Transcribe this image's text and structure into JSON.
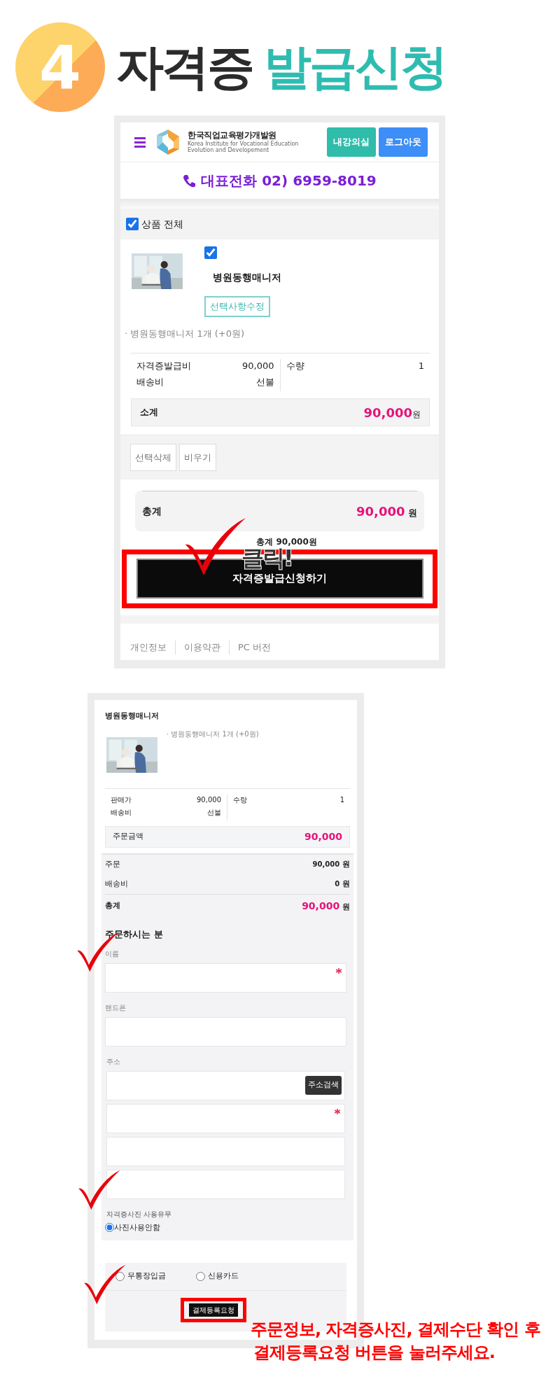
{
  "heading": {
    "step": "4",
    "title_dark": "자격증",
    "title_accent": "발급신청"
  },
  "cart_screen": {
    "header": {
      "logo_name": "한국직업교육평가개발원",
      "logo_lines": [
        "Korea Institute for Vocational Education",
        "Evolution and Developement"
      ],
      "buttons": [
        "내강의실",
        "로그아웃"
      ]
    },
    "phone": "대표전화 02) 6959-8019",
    "select_all": {
      "label": "상품 전체",
      "checked": true
    },
    "item": {
      "checked": true,
      "name": "병원동행매니저",
      "edit_button": "선택사항수정",
      "option": "· 병원동행매니저 1개 (+0원)"
    },
    "details": [
      {
        "label": "자격증발급비",
        "value": "90,000"
      },
      {
        "label": "배송비",
        "value": "선불"
      }
    ],
    "quantity": {
      "label": "수량",
      "value": "1"
    },
    "subtotal": {
      "label": "소계",
      "amount": "90,000",
      "unit": "원"
    },
    "actions": [
      "선택삭제",
      "비우기"
    ],
    "total": {
      "label": "총계",
      "amount": "90,000",
      "unit": "원"
    },
    "total_note": "총계 90,000원",
    "order_button": "자격증발급신청하기",
    "click_label": "클릭!",
    "footer_links": [
      "개인정보",
      "이용약관",
      "PC 버전"
    ]
  },
  "order_screen": {
    "product_name": "병원동행매니저",
    "option": "· 병원동행매니저 1개 (+0원)",
    "details": [
      {
        "label": "판매가",
        "value": "90,000"
      },
      {
        "label": "배송비",
        "value": "선불"
      }
    ],
    "quantity": {
      "label": "수량",
      "value": "1"
    },
    "order_amount": {
      "label": "주문금액",
      "amount": "90,000"
    },
    "summary": [
      {
        "kind": "plain",
        "label": "주문",
        "amount": "90,000",
        "unit": "원"
      },
      {
        "kind": "plain",
        "label": "배송비",
        "amount": "0",
        "unit": "원"
      },
      {
        "kind": "total",
        "label": "총계",
        "amount": "90,000",
        "unit": "원"
      }
    ],
    "orderer": {
      "title": "주문하시는 분",
      "fields": [
        {
          "label": "이름",
          "required": true
        },
        {
          "label": "핸드폰",
          "required": false
        }
      ],
      "address": {
        "label": "주소",
        "search_button": "주소검색",
        "lines": [
          {
            "required": false
          },
          {
            "required": true
          },
          {
            "required": false
          },
          {
            "required": false
          }
        ]
      }
    },
    "photo": {
      "label": "자격증사진 사용유무",
      "options": [
        {
          "label": "사진사용안함",
          "selected": true
        }
      ]
    },
    "payment": {
      "options": [
        {
          "label": "무통장입금",
          "selected": false
        },
        {
          "label": "신용카드",
          "selected": false
        }
      ]
    },
    "submit_button": "결제등록요청"
  },
  "instruction": [
    "주문정보, 자격증사진, 결제수단 확인 후",
    "결제등록요청 버튼을 눌러주세요."
  ]
}
